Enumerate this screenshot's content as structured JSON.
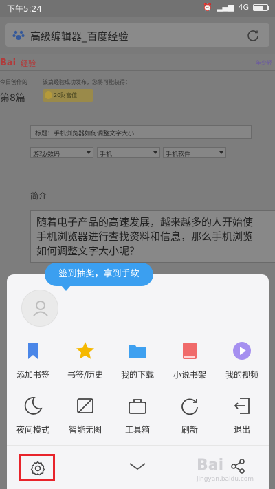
{
  "status_bar": {
    "time": "下午5:24",
    "network": "4G"
  },
  "browser": {
    "tab_title": "高级编辑器_百度经验",
    "icons": [
      "paw-icon",
      "reload-icon"
    ]
  },
  "background_page": {
    "logo": "Bai",
    "logo_suffix": "经验",
    "top_link": "年少轻",
    "today_label": "今日创作的",
    "today_count": "第8篇",
    "publish_note": "该篇经验成功发布，您将可能获得：",
    "reward_text": "20财富值",
    "title_field": "标题：手机浏览器如何调整文字大小",
    "selects": [
      "游戏/数码",
      "手机",
      "手机软件"
    ],
    "intro_label": "简介",
    "intro_text": "随着电子产品的高速发展，越来越多的人开始使\n手机浏览器进行查找资料和信息，那么手机浏览\n如何调整文字大小呢？"
  },
  "menu": {
    "tip": "签到抽奖，拿到手软",
    "row1": [
      {
        "label": "添加书签",
        "icon": "bookmark-icon",
        "color": "#4a86e8"
      },
      {
        "label": "书签/历史",
        "icon": "star-icon",
        "color": "#f5b800"
      },
      {
        "label": "我的下载",
        "icon": "folder-icon",
        "color": "#3ea0f0"
      },
      {
        "label": "小说书架",
        "icon": "book-icon",
        "color": "#f06a6a"
      },
      {
        "label": "我的视频",
        "icon": "play-icon",
        "color": "#a58ff0"
      }
    ],
    "row2": [
      {
        "label": "夜间模式",
        "icon": "moon-icon"
      },
      {
        "label": "智能无图",
        "icon": "no-image-icon"
      },
      {
        "label": "工具箱",
        "icon": "toolbox-icon"
      },
      {
        "label": "刷新",
        "icon": "refresh-icon"
      },
      {
        "label": "退出",
        "icon": "exit-icon"
      }
    ],
    "footer_icons": [
      "gear-icon",
      "chevron-down-icon",
      "share-icon"
    ],
    "highlight_color": "#e8242b"
  },
  "watermark": {
    "text": "Bai",
    "sub": "jingyan.baidu.com"
  }
}
